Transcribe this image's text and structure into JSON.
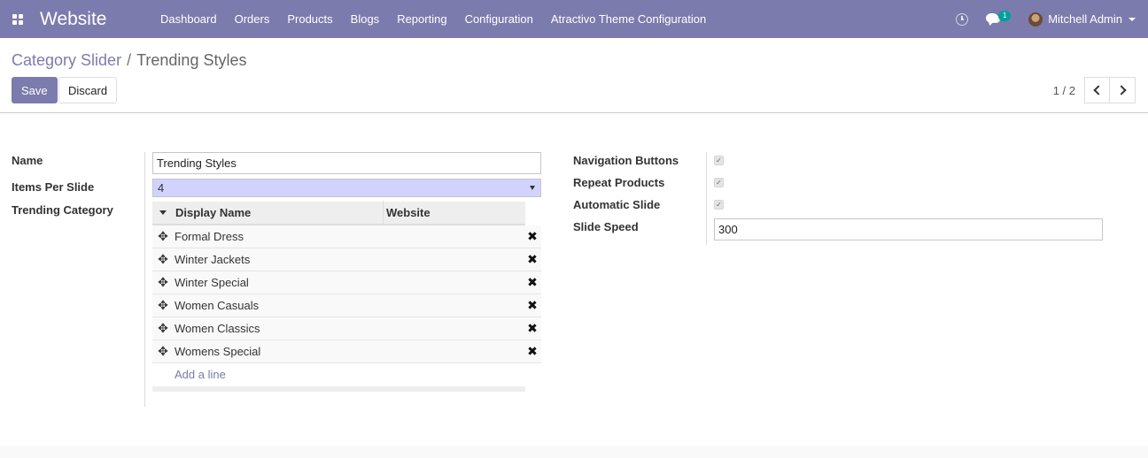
{
  "navbar": {
    "app_name": "Website",
    "menu": [
      "Dashboard",
      "Orders",
      "Products",
      "Blogs",
      "Reporting",
      "Configuration",
      "Atractivo Theme Configuration"
    ],
    "message_count": "1",
    "user_name": "Mitchell Admin",
    "color": "#7c7bad"
  },
  "breadcrumb": {
    "parent": "Category Slider",
    "separator": "/",
    "current": "Trending Styles"
  },
  "buttons": {
    "save": "Save",
    "discard": "Discard"
  },
  "pager": {
    "value": "1 / 2"
  },
  "form": {
    "name_label": "Name",
    "name_value": "Trending Styles",
    "items_per_slide_label": "Items Per Slide",
    "items_per_slide_value": "4",
    "trending_category_label": "Trending Category",
    "table": {
      "columns": [
        "Display Name",
        "Website"
      ],
      "rows": [
        "Formal Dress",
        "Winter Jackets",
        "Winter Special",
        "Women Casuals",
        "Women Classics",
        "Womens Special"
      ],
      "add_line": "Add a line"
    },
    "navigation_buttons_label": "Navigation Buttons",
    "navigation_buttons_checked": true,
    "repeat_products_label": "Repeat Products",
    "repeat_products_checked": true,
    "automatic_slide_label": "Automatic Slide",
    "automatic_slide_checked": true,
    "slide_speed_label": "Slide Speed",
    "slide_speed_value": "300"
  },
  "icons": {
    "apps": "apps-grid-icon",
    "activity": "clock-icon",
    "messages": "chat-icon",
    "move": "arrows-move-icon",
    "delete": "close-icon"
  }
}
